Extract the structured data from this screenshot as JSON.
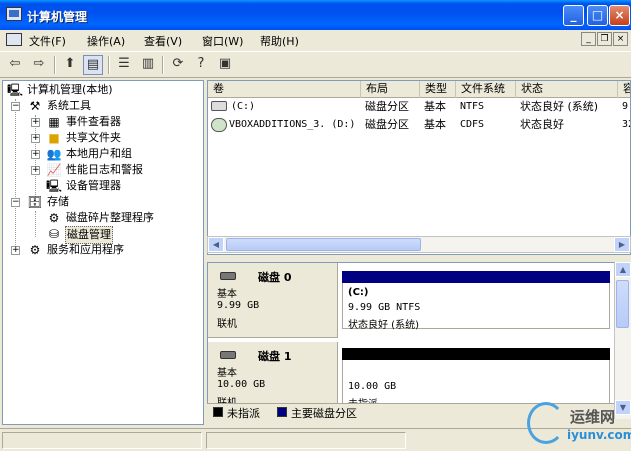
{
  "window": {
    "title": "计算机管理",
    "min_label": "_",
    "max_label": "□",
    "close_label": "×"
  },
  "menu": [
    {
      "label": "文件(F)"
    },
    {
      "label": "操作(A)"
    },
    {
      "label": "查看(V)"
    },
    {
      "label": "窗口(W)"
    },
    {
      "label": "帮助(H)"
    }
  ],
  "toolbar": {
    "icons": [
      "back-icon",
      "forward-icon",
      "up-folder-icon",
      "show-tree-icon",
      "properties-icon",
      "export-list-icon",
      "refresh-icon",
      "help-icon",
      "console-icon"
    ],
    "glyphs": {
      "back": "⇦",
      "forward": "⇨",
      "up": "⬆",
      "tree": "▤",
      "props": "☰",
      "list": "▥",
      "refresh": "⟳",
      "help": "?",
      "console": "▣"
    }
  },
  "tree": {
    "root": "计算机管理(本地)",
    "items": [
      {
        "label": "系统工具",
        "expander": "−"
      },
      {
        "label": "事件查看器",
        "expander": "+"
      },
      {
        "label": "共享文件夹",
        "expander": "+"
      },
      {
        "label": "本地用户和组",
        "expander": "+"
      },
      {
        "label": "性能日志和警报",
        "expander": "+"
      },
      {
        "label": "设备管理器"
      },
      {
        "label": "存储",
        "expander": "−"
      },
      {
        "label": "磁盘碎片整理程序"
      },
      {
        "label": "磁盘管理"
      },
      {
        "label": "服务和应用程序",
        "expander": "+"
      }
    ],
    "root_expander": "−"
  },
  "volumes": {
    "headers": [
      "卷",
      "布局",
      "类型",
      "文件系统",
      "状态",
      "容"
    ],
    "rows": [
      {
        "volume": "(C:)",
        "layout": "磁盘分区",
        "type": "基本",
        "fs": "NTFS",
        "status": "状态良好 (系统)",
        "cap": "9."
      },
      {
        "volume": "VBOXADDITIONS_3.  (D:)",
        "layout": "磁盘分区",
        "type": "基本",
        "fs": "CDFS",
        "status": "状态良好",
        "cap": "32"
      }
    ]
  },
  "disks": [
    {
      "name": "磁盘 0",
      "type": "基本",
      "size": "9.99 GB",
      "state": "联机",
      "partition": {
        "title": "(C:)",
        "detail": "9.99 GB NTFS",
        "status": "状态良好 (系统)",
        "color": "#000080"
      }
    },
    {
      "name": "磁盘 1",
      "type": "基本",
      "size": "10.00 GB",
      "state": "联机",
      "partition": {
        "title": "",
        "detail": "10.00 GB",
        "status": "未指派",
        "color": "#000000"
      }
    }
  ],
  "legend": [
    {
      "label": "未指派",
      "color": "#000000"
    },
    {
      "label": "主要磁盘分区",
      "color": "#000080"
    }
  ],
  "watermark": {
    "line1": "运维网",
    "line2": "iyunv.com"
  },
  "colors": {
    "title_bar": "#0054E3",
    "selection": "#ECE9D8",
    "primary_partition": "#000080",
    "unallocated": "#000000"
  }
}
